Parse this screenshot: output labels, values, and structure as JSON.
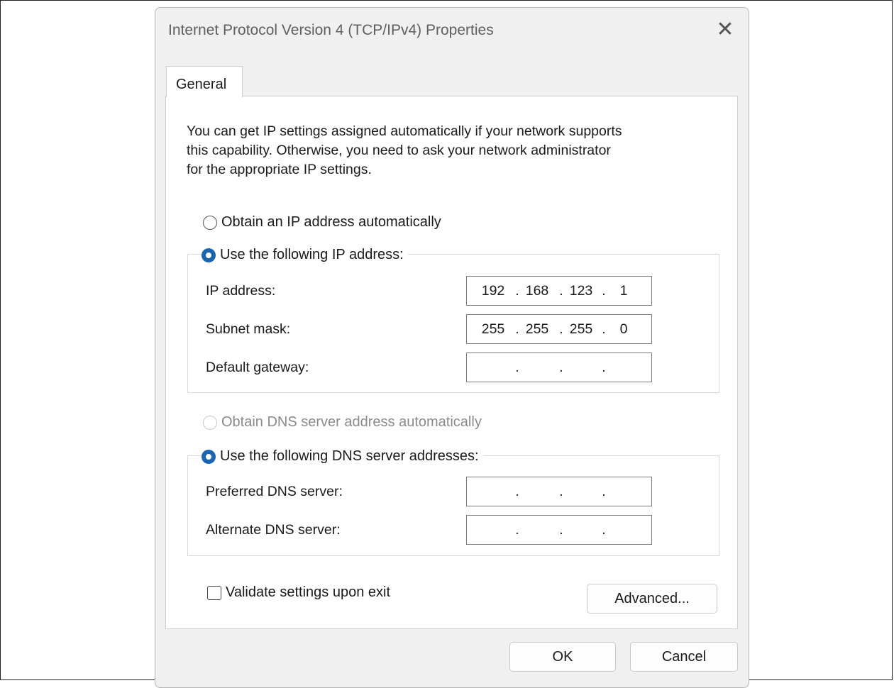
{
  "window": {
    "title": "Internet Protocol Version 4 (TCP/IPv4) Properties",
    "close_glyph": "✕"
  },
  "tabs": [
    {
      "label": "General"
    }
  ],
  "intro": [
    "You can get IP settings assigned automatically if your network supports",
    "this capability. Otherwise, you need to ask your network administrator",
    "for the appropriate IP settings."
  ],
  "ip_section": {
    "auto_label": "Obtain an IP address automatically",
    "manual_label": "Use the following IP address:",
    "selected": "manual",
    "fields": [
      {
        "label": "IP address:",
        "octets": [
          "192",
          "168",
          "123",
          "1"
        ]
      },
      {
        "label": "Subnet mask:",
        "octets": [
          "255",
          "255",
          "255",
          "0"
        ]
      },
      {
        "label": "Default gateway:",
        "octets": [
          "",
          "",
          "",
          ""
        ]
      }
    ]
  },
  "dns_section": {
    "auto_label": "Obtain DNS server address automatically",
    "manual_label": "Use the following DNS server addresses:",
    "selected": "manual",
    "fields": [
      {
        "label": "Preferred DNS server:",
        "octets": [
          "",
          "",
          "",
          ""
        ]
      },
      {
        "label": "Alternate DNS server:",
        "octets": [
          "",
          "",
          "",
          ""
        ]
      }
    ]
  },
  "validate": {
    "label": "Validate settings upon exit",
    "checked": false
  },
  "buttons": {
    "advanced": "Advanced...",
    "ok": "OK",
    "cancel": "Cancel"
  },
  "colors": {
    "accent": "#1b64b0",
    "dialog_bg": "#f0f0f0",
    "panel_bg": "#ffffff"
  },
  "icons": {
    "close": "close-icon"
  }
}
